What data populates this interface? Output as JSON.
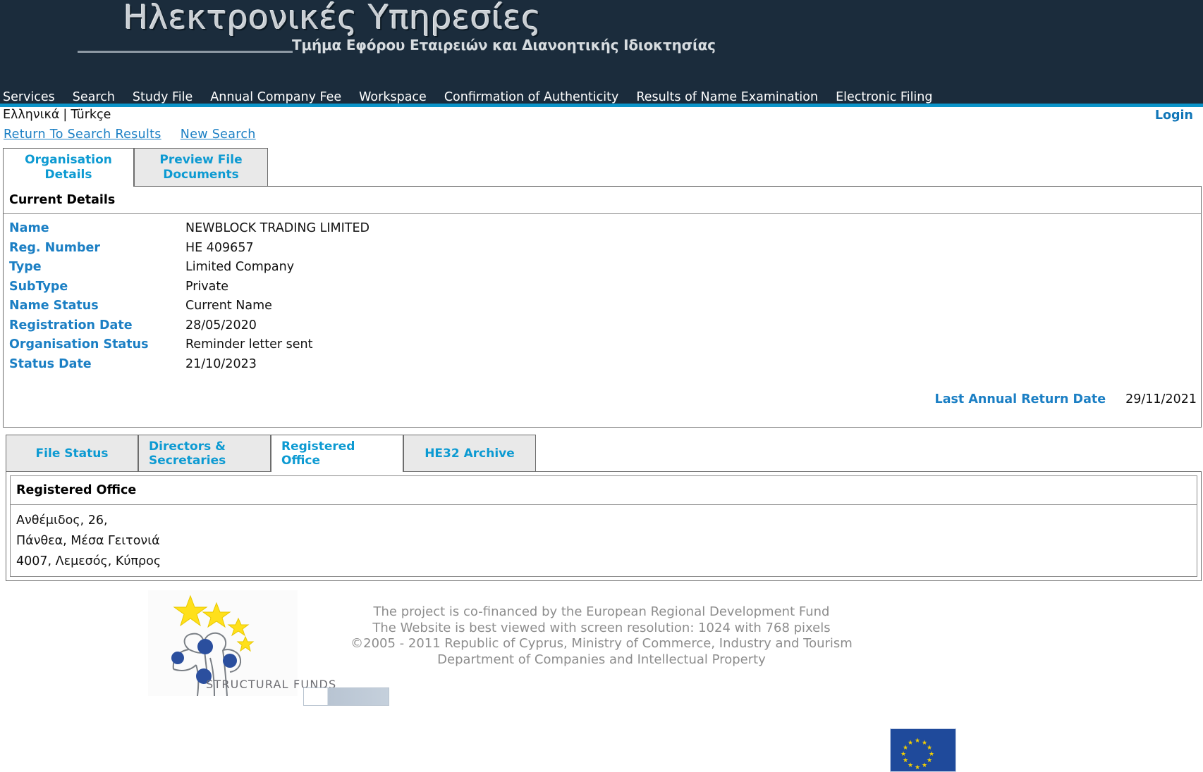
{
  "header": {
    "brand_title": "Ηλεκτρονικές Υπηρεσίες",
    "brand_subtitle": "Τμήμα Εφόρου Εταιρειών και Διανοητικής Ιδιοκτησίας",
    "bg_color": "#1b2c3c",
    "accent_color": "#0b94c9"
  },
  "nav": {
    "items": [
      {
        "label": "Services"
      },
      {
        "label": "Search"
      },
      {
        "label": "Study File"
      },
      {
        "label": "Annual Company Fee"
      },
      {
        "label": "Workspace"
      },
      {
        "label": "Confirmation of Authenticity"
      },
      {
        "label": "Results of Name Examination"
      },
      {
        "label": "Electronic Filing"
      }
    ]
  },
  "langbar": {
    "greek": "Ελληνικά",
    "separator": "|",
    "turkish": "Türkçe",
    "login": "Login"
  },
  "actions": {
    "return_to_search_results": "Return To Search Results",
    "new_search": "New Search"
  },
  "top_tabs": [
    {
      "label": "Organisation Details",
      "active": true
    },
    {
      "label": "Preview File Documents",
      "active": false
    }
  ],
  "current_details": {
    "panel_title": "Current Details",
    "rows": [
      {
        "label": "Name",
        "value": "NEWBLOCK TRADING LIMITED"
      },
      {
        "label": "Reg. Number",
        "value": "HE 409657"
      },
      {
        "label": "Type",
        "value": "Limited Company"
      },
      {
        "label": "SubType",
        "value": "Private"
      },
      {
        "label": "Name Status",
        "value": "Current Name"
      },
      {
        "label": "Registration Date",
        "value": "28/05/2020"
      },
      {
        "label": "Organisation Status",
        "value": "Reminder letter sent"
      },
      {
        "label": "Status Date",
        "value": "21/10/2023"
      }
    ],
    "last_annual_return_label": "Last Annual Return Date",
    "last_annual_return_value": "29/11/2021"
  },
  "sub_tabs": [
    {
      "label": "File Status",
      "active": false
    },
    {
      "label": "Directors & Secretaries",
      "active": false
    },
    {
      "label": "Registered Office",
      "active": true
    },
    {
      "label": "HE32 Archive",
      "active": false
    }
  ],
  "registered_office": {
    "title": "Registered Office",
    "lines": [
      "Ανθέμιδος, 26,",
      "Πάνθεα, Μέσα Γειτονιά",
      "4007, Λεμεσός, Κύπρος"
    ]
  },
  "footer": {
    "structural_funds_caption": "STRUCTURAL FUNDS",
    "lines": [
      "The project is co-financed by the European Regional Development Fund",
      "The Website is best viewed with screen resolution: 1024 with 768 pixels",
      "©2005 - 2011 Republic of Cyprus, Ministry of Commerce, Industry and Tourism",
      "Department of Companies and Intellectual Property"
    ]
  }
}
